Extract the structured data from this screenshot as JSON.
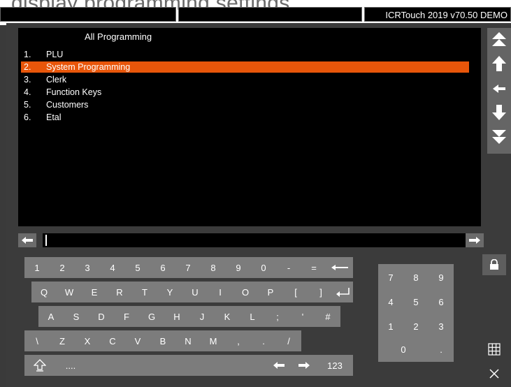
{
  "background_caption": "display programming settings",
  "header": {
    "version": "ICRTouch 2019 v70.50 DEMO"
  },
  "list": {
    "title": "All Programming",
    "items": [
      {
        "num": "1.",
        "label": "PLU"
      },
      {
        "num": "2.",
        "label": "System Programming",
        "selected": true
      },
      {
        "num": "3.",
        "label": "Clerk"
      },
      {
        "num": "4.",
        "label": "Function Keys"
      },
      {
        "num": "5.",
        "label": "Customers"
      },
      {
        "num": "6.",
        "label": "Etal"
      }
    ]
  },
  "input": {
    "value": ""
  },
  "keyboard": {
    "row1": [
      "1",
      "2",
      "3",
      "4",
      "5",
      "6",
      "7",
      "8",
      "9",
      "0",
      "-",
      "="
    ],
    "row2": [
      "Q",
      "W",
      "E",
      "R",
      "T",
      "Y",
      "U",
      "I",
      "O",
      "P",
      "[",
      "]"
    ],
    "row3": [
      "A",
      "S",
      "D",
      "F",
      "G",
      "H",
      "J",
      "K",
      "L",
      ";",
      "'",
      "#"
    ],
    "row4": [
      "\\",
      "Z",
      "X",
      "C",
      "V",
      "B",
      "N",
      "M",
      ",",
      ".",
      "/"
    ],
    "symbols_label": "....",
    "mode_label": "123"
  },
  "numpad": {
    "keys": [
      "7",
      "8",
      "9",
      "4",
      "5",
      "6",
      "1",
      "2",
      "3",
      "0",
      "."
    ]
  },
  "colors": {
    "accent": "#e8560a",
    "panel": "#000000",
    "key": "#7c7c7c",
    "background": "#3b3b3b"
  },
  "icons": [
    "double-up-arrow-icon",
    "up-arrow-icon",
    "back-arrow-icon",
    "down-arrow-icon",
    "double-down-arrow-icon",
    "left-arrow-icon",
    "right-arrow-icon",
    "lock-icon",
    "grid-icon",
    "close-icon",
    "backspace-icon",
    "enter-icon",
    "shift-icon"
  ]
}
